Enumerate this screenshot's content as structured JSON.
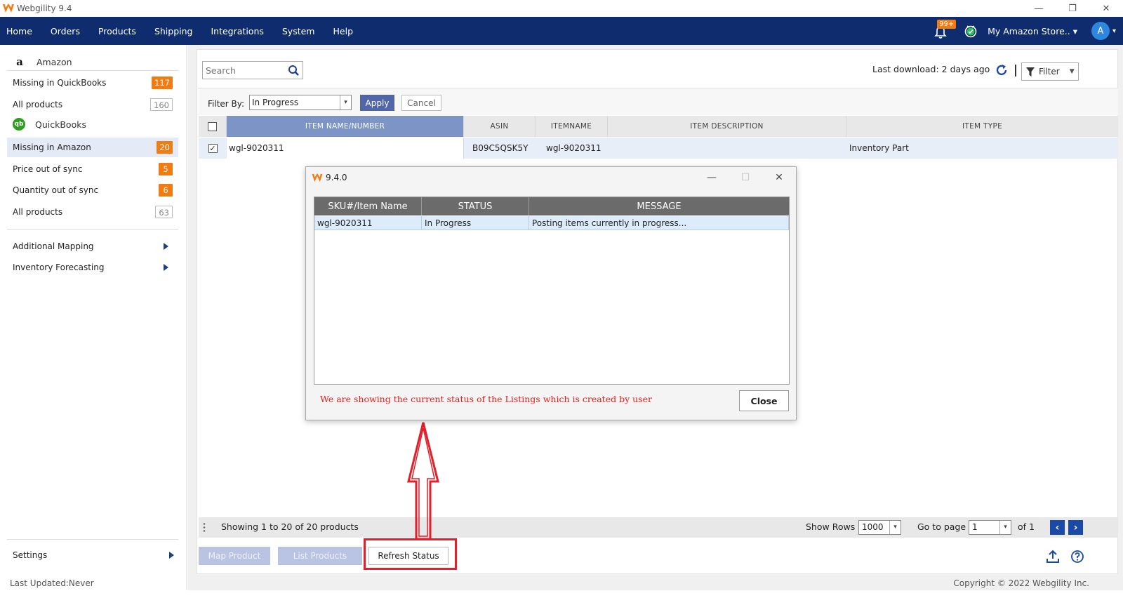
{
  "window": {
    "title": "Webgility 9.4",
    "controls": [
      "—",
      "❐",
      "✕"
    ]
  },
  "nav": {
    "items": [
      "Home",
      "Orders",
      "Products",
      "Shipping",
      "Integrations",
      "System",
      "Help"
    ],
    "notifications_badge": "99+",
    "store": "My Amazon Store..",
    "avatar_initial": "A"
  },
  "sidebar": {
    "amazon_heading": "Amazon",
    "quickbooks_heading": "QuickBooks",
    "amazon_items": [
      {
        "label": "Missing in QuickBooks",
        "count": "117"
      },
      {
        "label": "All products",
        "count": "160"
      }
    ],
    "quickbooks_items": [
      {
        "label": "Missing in Amazon",
        "count": "20"
      },
      {
        "label": "Price out of sync",
        "count": "5"
      },
      {
        "label": "Quantity out of sync",
        "count": "6"
      },
      {
        "label": "All products",
        "count": "63"
      }
    ],
    "extra_items": [
      "Additional Mapping",
      "Inventory Forecasting"
    ],
    "settings": "Settings",
    "last_updated": "Last Updated:Never"
  },
  "toolbar": {
    "search_placeholder": "Search",
    "last_download": "Last download: 2 days ago",
    "filter_label": "Filter"
  },
  "filter_row": {
    "label": "Filter By:",
    "selected": "In Progress",
    "apply": "Apply",
    "cancel": "Cancel"
  },
  "grid": {
    "columns": [
      "ITEM NAME/NUMBER",
      "ASIN",
      "ITEMNAME",
      "ITEM DESCRIPTION",
      "ITEM TYPE"
    ],
    "rows": [
      {
        "checked": true,
        "item_name": "wgl-9020311",
        "asin": "B09C5QSK5Y",
        "itemname": "wgl-9020311",
        "description": "",
        "type": "Inventory Part"
      }
    ]
  },
  "pager": {
    "showing": "Showing 1 to 20 of 20 products",
    "show_rows_label": "Show Rows",
    "show_rows_value": "1000",
    "goto_label": "Go to page",
    "page_value": "1",
    "of_label": "of 1"
  },
  "actions": {
    "map_product": "Map Product",
    "list_products": "List Products",
    "refresh_status": "Refresh Status"
  },
  "dialog": {
    "title": "9.4.0",
    "columns": [
      "SKU#/Item Name",
      "STATUS",
      "MESSAGE"
    ],
    "rows": [
      {
        "sku": "wgl-9020311",
        "status": "In Progress",
        "message": "Posting items currently in progress..."
      }
    ],
    "note": "We are showing the current status of the Listings which is created by user",
    "close": "Close"
  },
  "footer": {
    "copyright": "Copyright © 2022 Webgility Inc."
  },
  "colors": {
    "nav_bg": "#0f2d6e",
    "accent_orange": "#f07c12",
    "highlight_red": "#e0202a",
    "apply_blue": "#5066a8"
  },
  "icons": [
    "webgility-logo",
    "bell-icon",
    "sync-check-icon",
    "amazon-icon",
    "quickbooks-icon",
    "search-icon",
    "refresh-icon",
    "filter-icon",
    "upload-icon",
    "help-icon",
    "up-arrow-annotation"
  ]
}
